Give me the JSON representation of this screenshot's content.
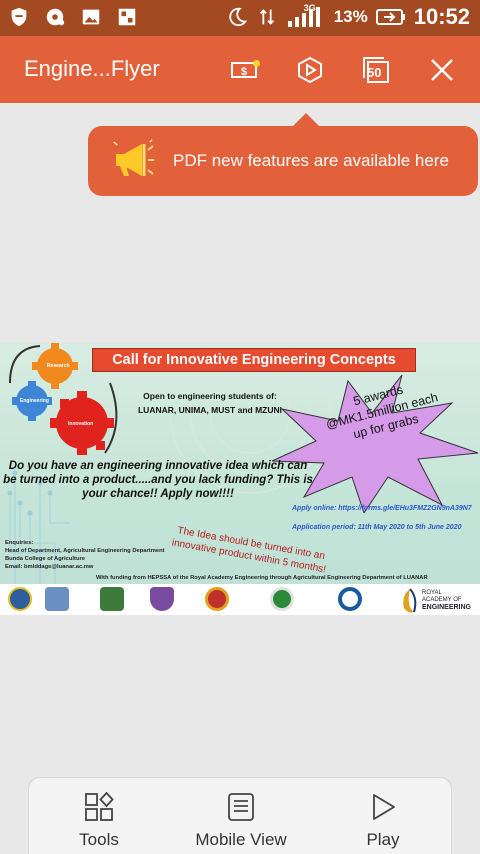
{
  "status_bar": {
    "network": "3G",
    "battery": "13%",
    "time": "10:52"
  },
  "app_bar": {
    "title": "Engine...Flyer",
    "page_badge": "50",
    "icons": [
      "money-scan-icon",
      "play-hexagon-icon",
      "page-count-icon",
      "close-icon"
    ]
  },
  "tooltip": {
    "text": "PDF new features are available here"
  },
  "flyer": {
    "title": "Call for Innovative Engineering Concepts",
    "open_to_line1": "Open to engineering students of:",
    "open_to_line2": "LUANAR, UNIMA, MUST and MZUNI",
    "question": "Do you have an engineering innovative idea which can be turned into a product.....and you lack funding? This is your chance!! Apply now!!!!",
    "awards_line1": "5 awards",
    "awards_line2": "@MK1.5million each",
    "awards_line3": "up for grabs",
    "apply_online": "Apply online: https://forms.gle/EHu3FMZ2GN9nA39N7",
    "application_period": "Application period: 11th May 2020 to 5th June 2020",
    "idea_note": "The Idea should be turned into an innovative product within 5 months!",
    "enquiries_label": "Enquiries:",
    "enquiries_line1": "Head of Department, Agricultural Engineering Department",
    "enquiries_line2": "Bunda College of Agriculture",
    "enquiries_line3": "Email: bmlddage@luanar.ac.mw",
    "funding_note": "With funding from HEPSSA of the Royal Academy Engineering through Agricultural Engineering Department of LUANAR",
    "gears": [
      "Research",
      "Engineering",
      "Innovation"
    ],
    "royal_line1": "ROYAL",
    "royal_line2": "ACADEMY OF",
    "royal_line3": "ENGINEERING"
  },
  "bottom_bar": {
    "tools": "Tools",
    "mobile_view": "Mobile View",
    "play": "Play"
  },
  "colors": {
    "status_bar": "#a34a22",
    "app_bar": "#e2603a",
    "flyer_title_bg": "#e64a2f"
  }
}
